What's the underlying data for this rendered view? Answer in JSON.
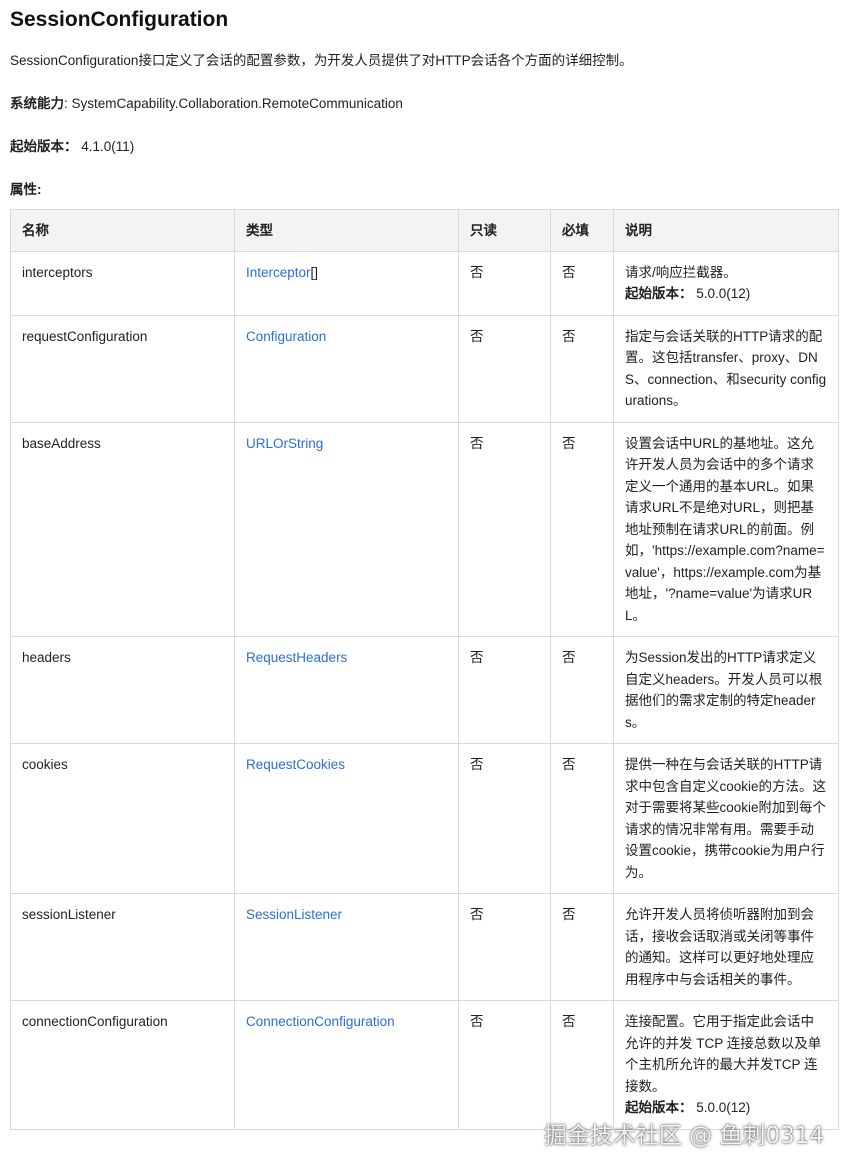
{
  "title": "SessionConfiguration",
  "intro": "SessionConfiguration接口定义了会话的配置参数，为开发人员提供了对HTTP会话各个方面的详细控制。",
  "syscap": {
    "label": "系统能力",
    "sep": ": ",
    "value": "SystemCapability.Collaboration.RemoteCommunication"
  },
  "since": {
    "label": "起始版本：",
    "value": "4.1.0(11)"
  },
  "attrs_label": "属性:",
  "table": {
    "headers": [
      "名称",
      "类型",
      "只读",
      "必填",
      "说明"
    ],
    "rows": [
      {
        "name": "interceptors",
        "type": "Interceptor",
        "type_suffix": "[]",
        "readonly": "否",
        "required": "否",
        "desc": "请求/响应拦截器。",
        "since_label": "起始版本：",
        "since_value": "5.0.0(12)"
      },
      {
        "name": "requestConfiguration",
        "type": "Configuration",
        "type_suffix": "",
        "readonly": "否",
        "required": "否",
        "desc": "指定与会话关联的HTTP请求的配置。这包括transfer、proxy、DNS、connection、和security configurations。",
        "since_label": "",
        "since_value": ""
      },
      {
        "name": "baseAddress",
        "type": "URLOrString",
        "type_suffix": "",
        "readonly": "否",
        "required": "否",
        "desc": "设置会话中URL的基地址。这允许开发人员为会话中的多个请求定义一个通用的基本URL。如果请求URL不是绝对URL，则把基地址预制在请求URL的前面。例如，'https://example.com?name=value'，https://example.com为基地址，'?name=value'为请求URL。",
        "since_label": "",
        "since_value": ""
      },
      {
        "name": "headers",
        "type": "RequestHeaders",
        "type_suffix": "",
        "readonly": "否",
        "required": "否",
        "desc": "为Session发出的HTTP请求定义自定义headers。开发人员可以根据他们的需求定制的特定headers。",
        "since_label": "",
        "since_value": ""
      },
      {
        "name": "cookies",
        "type": "RequestCookies",
        "type_suffix": "",
        "readonly": "否",
        "required": "否",
        "desc": "提供一种在与会话关联的HTTP请求中包含自定义cookie的方法。这对于需要将某些cookie附加到每个请求的情况非常有用。需要手动设置cookie，携带cookie为用户行为。",
        "since_label": "",
        "since_value": ""
      },
      {
        "name": "sessionListener",
        "type": "SessionListener",
        "type_suffix": "",
        "readonly": "否",
        "required": "否",
        "desc": "允许开发人员将侦听器附加到会话，接收会话取消或关闭等事件的通知。这样可以更好地处理应用程序中与会话相关的事件。",
        "since_label": "",
        "since_value": ""
      },
      {
        "name": "connectionConfiguration",
        "type": "ConnectionConfiguration",
        "type_suffix": "",
        "readonly": "否",
        "required": "否",
        "desc": "连接配置。它用于指定此会话中允许的并发 TCP 连接总数以及单个主机所允许的最大并发TCP 连接数。",
        "since_label": "起始版本：",
        "since_value": "5.0.0(12)"
      }
    ]
  },
  "watermark": "掘金技术社区 @ 鱼刺0314"
}
